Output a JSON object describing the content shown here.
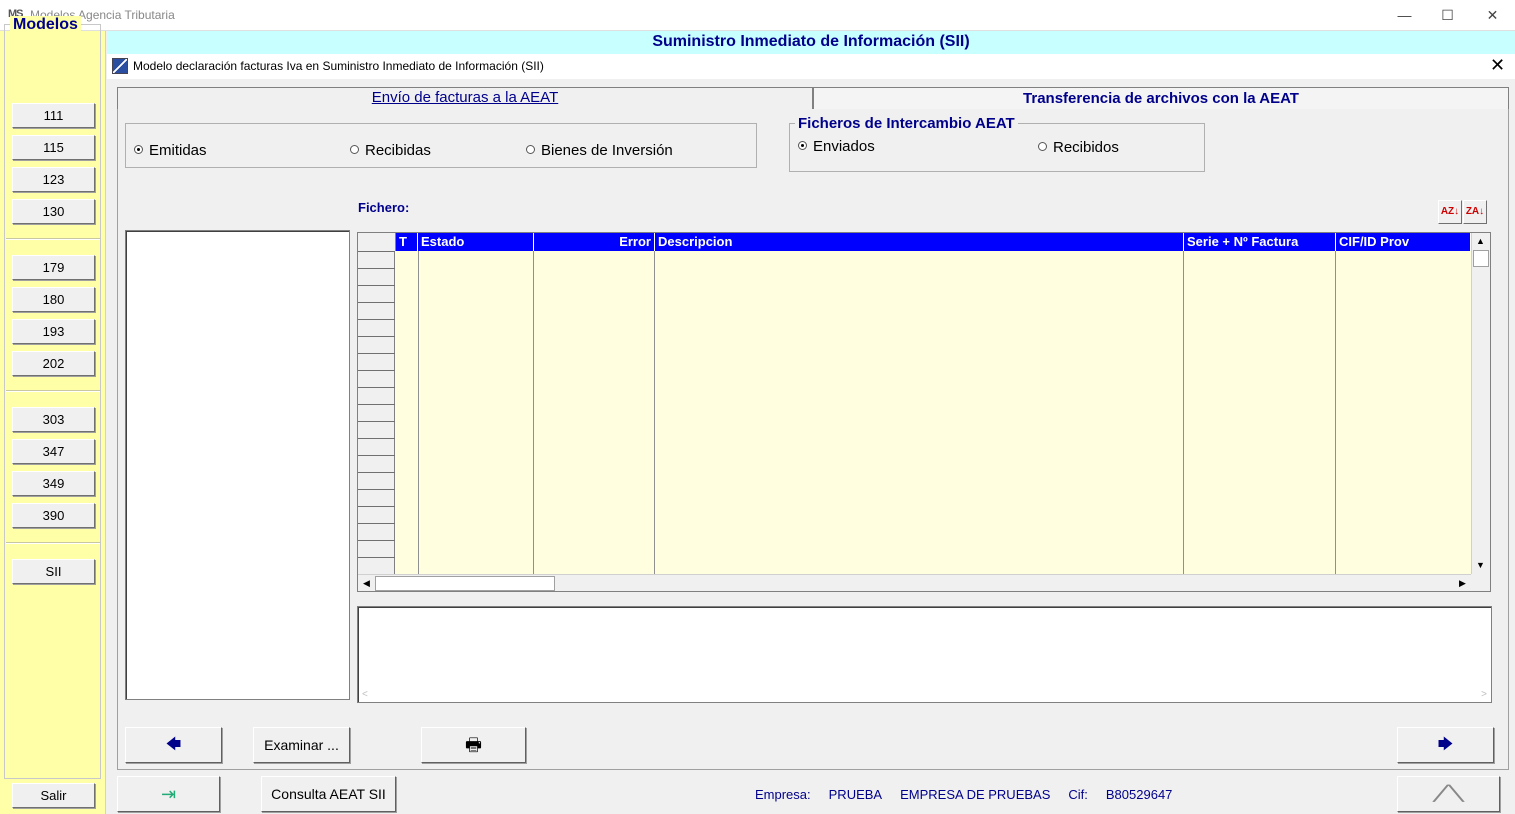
{
  "window": {
    "logo": "MS",
    "title": "Modelos Agencia Tributaria",
    "minimize": "—",
    "maximize": "☐",
    "close": "✕"
  },
  "sidebar": {
    "title": "Modelos",
    "items": [
      "111",
      "115",
      "123",
      "130",
      "179",
      "180",
      "193",
      "202",
      "303",
      "347",
      "349",
      "390",
      "SII"
    ],
    "exit_label": "Salir"
  },
  "header": {
    "title": "Suministro Inmediato de Información (SII)"
  },
  "inner_window": {
    "title": "Modelo declaración facturas Iva en Suministro Inmediato de Información (SII)",
    "close": "✕"
  },
  "tabs": [
    {
      "label": "Envío de facturas a la AEAT"
    },
    {
      "label": "Transferencia de archivos con la AEAT"
    }
  ],
  "type_group": {
    "options": [
      "Emitidas",
      "Recibidas",
      "Bienes de Inversión"
    ],
    "selected": "Emitidas"
  },
  "ficheros_group": {
    "title": "Ficheros de Intercambio AEAT",
    "options": [
      "Enviados",
      "Recibidos"
    ],
    "selected": "Enviados"
  },
  "fichero_label": "Fichero:",
  "sort_buttons": {
    "asc": "AZ↓",
    "desc": "ZA↓"
  },
  "grid": {
    "columns": [
      "T",
      "Estado",
      "Error",
      "Descripcion",
      "Serie + Nº Factura",
      "CIF/ID Prov"
    ],
    "rows": []
  },
  "buttons": {
    "prev": "🡄",
    "examinar": "Examinar ...",
    "print": "🖶",
    "next": "🡆",
    "consulta": "Consulta AEAT SII"
  },
  "status": {
    "empresa_label": "Empresa:",
    "empresa_code": "PRUEBA",
    "empresa_name": "EMPRESA DE PRUEBAS",
    "cif_label": "Cif:",
    "cif_value": "B80529647"
  },
  "colors": {
    "sidebar_bg": "#ffffa8",
    "header_bg": "#c8ffff",
    "grid_header": "#0000ff",
    "grid_bg": "#ffffe0",
    "accent_text": "#00008b"
  }
}
